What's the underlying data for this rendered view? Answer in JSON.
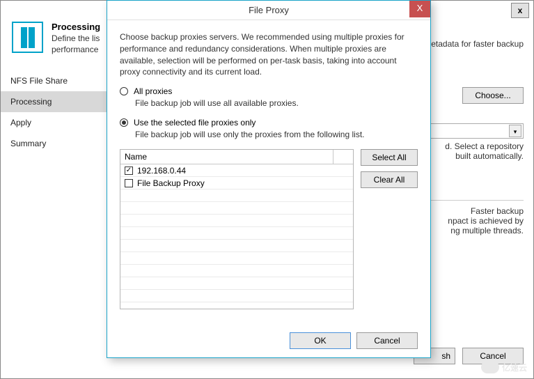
{
  "wizard": {
    "close_x": "x",
    "header_title": "Processing",
    "header_desc_1": "Define the lis",
    "header_desc_2": "performance",
    "header_desc_tail": "etadata for faster backup",
    "sidebar": [
      {
        "label": "NFS File Share",
        "active": false
      },
      {
        "label": "Processing",
        "active": true
      },
      {
        "label": "Apply",
        "active": false
      },
      {
        "label": "Summary",
        "active": false
      }
    ],
    "choose_btn": "Choose...",
    "paragraph1_line1": "d. Select a repository",
    "paragraph1_line2": "built automatically.",
    "paragraph2_line1": "Faster backup",
    "paragraph2_line2": "npact is achieved by",
    "paragraph2_line3": "ng multiple threads.",
    "finish_btn_tail": "sh",
    "cancel_btn": "Cancel"
  },
  "modal": {
    "title": "File Proxy",
    "close_x": "X",
    "description": "Choose backup proxies servers. We recommended using multiple proxies for performance and redundancy considerations. When multiple proxies are available, selection will be performed on per-task basis, taking into account proxy connectivity and its current load.",
    "radio_all": {
      "label": "All proxies",
      "sub": "File backup job will use all available proxies.",
      "selected": false
    },
    "radio_selected": {
      "label": "Use the selected file proxies only",
      "sub": "File backup job will use only the proxies from the following list.",
      "selected": true
    },
    "table": {
      "header": "Name",
      "rows": [
        {
          "checked": true,
          "label": "192.168.0.44"
        },
        {
          "checked": false,
          "label": "File Backup Proxy"
        }
      ]
    },
    "select_all": "Select All",
    "clear_all": "Clear All",
    "ok": "OK",
    "cancel": "Cancel"
  },
  "watermark": "亿速云"
}
